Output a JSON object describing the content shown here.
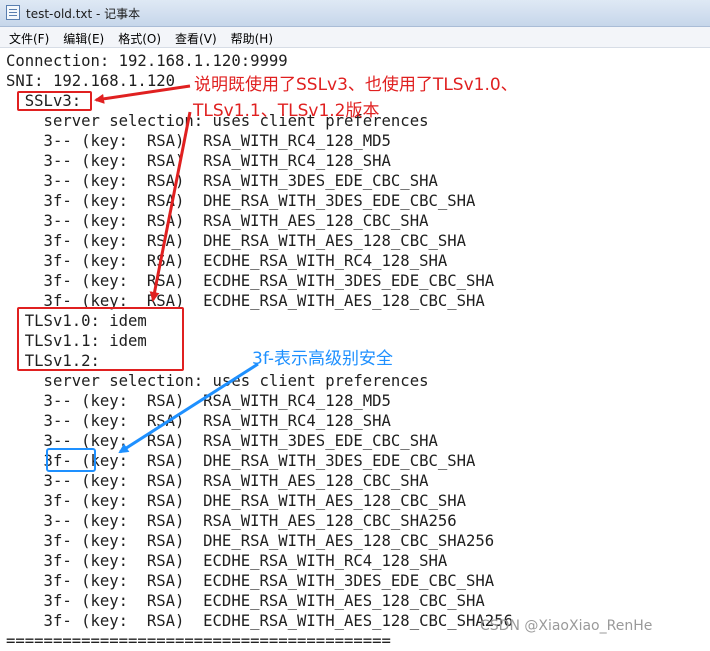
{
  "window": {
    "title": "test-old.txt - 记事本"
  },
  "menu": [
    "文件(F)",
    "编辑(E)",
    "格式(O)",
    "查看(V)",
    "帮助(H)"
  ],
  "lines": [
    "Connection: 192.168.1.120:9999",
    "SNI: 192.168.1.120",
    "  SSLv3:",
    "    server selection: uses client preferences",
    "    3-- (key:  RSA)  RSA_WITH_RC4_128_MD5",
    "    3-- (key:  RSA)  RSA_WITH_RC4_128_SHA",
    "    3-- (key:  RSA)  RSA_WITH_3DES_EDE_CBC_SHA",
    "    3f- (key:  RSA)  DHE_RSA_WITH_3DES_EDE_CBC_SHA",
    "    3-- (key:  RSA)  RSA_WITH_AES_128_CBC_SHA",
    "    3f- (key:  RSA)  DHE_RSA_WITH_AES_128_CBC_SHA",
    "    3f- (key:  RSA)  ECDHE_RSA_WITH_RC4_128_SHA",
    "    3f- (key:  RSA)  ECDHE_RSA_WITH_3DES_EDE_CBC_SHA",
    "    3f- (key:  RSA)  ECDHE_RSA_WITH_AES_128_CBC_SHA",
    "  TLSv1.0: idem",
    "  TLSv1.1: idem",
    "  TLSv1.2:",
    "    server selection: uses client preferences",
    "    3-- (key:  RSA)  RSA_WITH_RC4_128_MD5",
    "    3-- (key:  RSA)  RSA_WITH_RC4_128_SHA",
    "    3-- (key:  RSA)  RSA_WITH_3DES_EDE_CBC_SHA",
    "    3f- (key:  RSA)  DHE_RSA_WITH_3DES_EDE_CBC_SHA",
    "    3-- (key:  RSA)  RSA_WITH_AES_128_CBC_SHA",
    "    3f- (key:  RSA)  DHE_RSA_WITH_AES_128_CBC_SHA",
    "    3-- (key:  RSA)  RSA_WITH_AES_128_CBC_SHA256",
    "    3f- (key:  RSA)  DHE_RSA_WITH_AES_128_CBC_SHA256",
    "    3f- (key:  RSA)  ECDHE_RSA_WITH_RC4_128_SHA",
    "    3f- (key:  RSA)  ECDHE_RSA_WITH_3DES_EDE_CBC_SHA",
    "    3f- (key:  RSA)  ECDHE_RSA_WITH_AES_128_CBC_SHA",
    "    3f- (key:  RSA)  ECDHE_RSA_WITH_AES_128_CBC_SHA256",
    "========================================="
  ],
  "annotations": {
    "red_note_1": "说明既使用了SSLv3、也使用了TLSv1.0、",
    "red_note_2": "TLSv1.1、TLSv1.2版本",
    "blue_note": "3f-表示高级别安全"
  },
  "watermark": "CSDN @XiaoXiao_RenHe",
  "colors": {
    "annotation_red": "#e02020",
    "annotation_blue": "#1e90ff"
  }
}
